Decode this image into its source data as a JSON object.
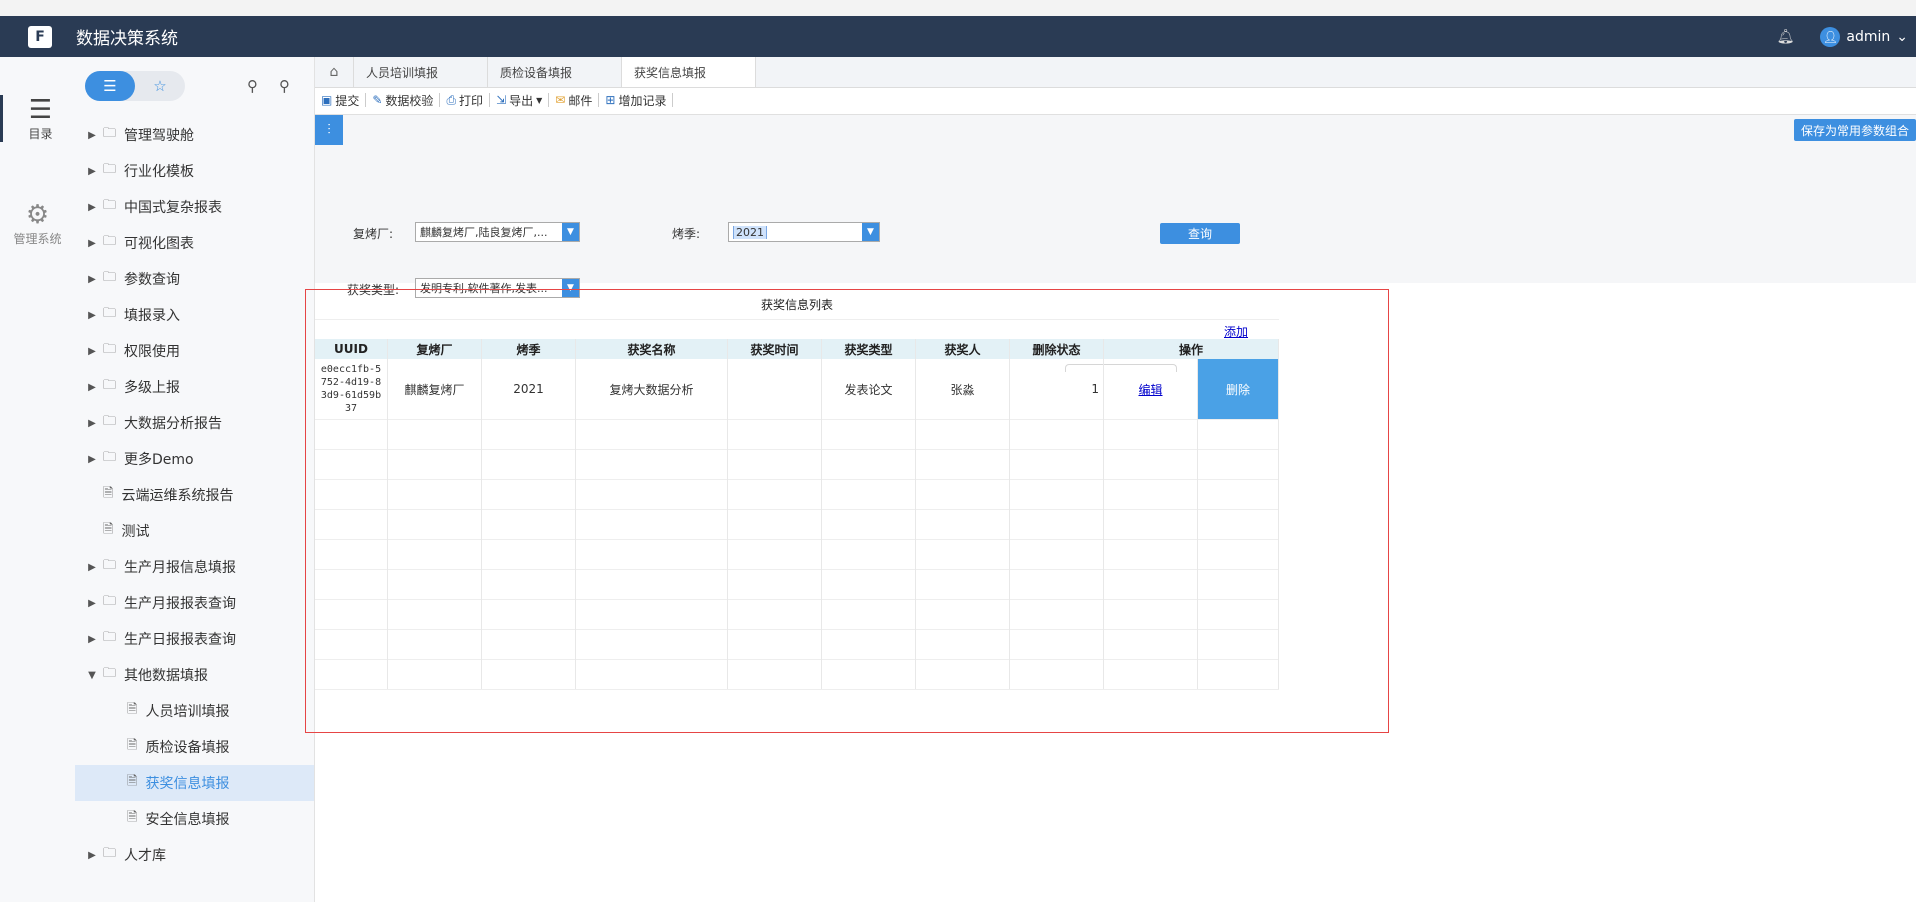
{
  "app": {
    "title": "数据决策系统",
    "logo_text": "F",
    "user": "admin"
  },
  "rail": {
    "items": [
      {
        "label": "目录"
      },
      {
        "label": "管理系统"
      }
    ]
  },
  "tree": {
    "items": [
      {
        "label": "管理驾驶舱",
        "type": "folder",
        "expanded": false
      },
      {
        "label": "行业化模板",
        "type": "folder",
        "expanded": false
      },
      {
        "label": "中国式复杂报表",
        "type": "folder",
        "expanded": false
      },
      {
        "label": "可视化图表",
        "type": "folder",
        "expanded": false
      },
      {
        "label": "参数查询",
        "type": "folder",
        "expanded": false
      },
      {
        "label": "填报录入",
        "type": "folder",
        "expanded": false
      },
      {
        "label": "权限使用",
        "type": "folder",
        "expanded": false
      },
      {
        "label": "多级上报",
        "type": "folder",
        "expanded": false
      },
      {
        "label": "大数据分析报告",
        "type": "folder",
        "expanded": false
      },
      {
        "label": "更多Demo",
        "type": "folder",
        "expanded": false
      },
      {
        "label": "云端运维系统报告",
        "type": "report"
      },
      {
        "label": "测试",
        "type": "report"
      },
      {
        "label": "生产月报信息填报",
        "type": "folder",
        "expanded": false
      },
      {
        "label": "生产月报报表查询",
        "type": "folder",
        "expanded": false
      },
      {
        "label": "生产日报报表查询",
        "type": "folder",
        "expanded": false
      },
      {
        "label": "其他数据填报",
        "type": "folder",
        "expanded": true
      },
      {
        "label": "人员培训填报",
        "type": "report",
        "child": true
      },
      {
        "label": "质检设备填报",
        "type": "report",
        "child": true
      },
      {
        "label": "获奖信息填报",
        "type": "report",
        "child": true,
        "selected": true
      },
      {
        "label": "安全信息填报",
        "type": "report",
        "child": true
      },
      {
        "label": "人才库",
        "type": "folder",
        "expanded": false
      }
    ]
  },
  "tabs": [
    {
      "label": "人员培训填报"
    },
    {
      "label": "质检设备填报"
    },
    {
      "label": "获奖信息填报",
      "active": true
    }
  ],
  "toolbar": {
    "submit": "提交",
    "verify": "数据校验",
    "print": "打印",
    "export": "导出",
    "mail": "邮件",
    "add_record": "增加记录"
  },
  "params": {
    "save_label": "保存为常用参数组合",
    "factory_label": "复烤厂:",
    "factory_value": "麒麟复烤厂,陆良复烤厂,...",
    "season_label": "烤季:",
    "season_value": "2021",
    "award_type_label": "获奖类型:",
    "award_type_value": "发明专利,软件著作,发表...",
    "query_label": "查询"
  },
  "grid": {
    "title": "获奖信息列表",
    "add_label": "添加",
    "headers": [
      "UUID",
      "复烤厂",
      "烤季",
      "获奖名称",
      "获奖时间",
      "获奖类型",
      "获奖人",
      "删除状态",
      "操作"
    ],
    "rows": [
      {
        "uuid": "e0ecc1fb-5752-4d19-83d9-61d59b37",
        "factory": "麒麟复烤厂",
        "season": "2021",
        "award_name": "复烤大数据分析",
        "award_time": "",
        "award_type": "发表论文",
        "winner": "张淼",
        "delete_status": "1",
        "edit": "编辑",
        "delete": "删除"
      }
    ]
  }
}
